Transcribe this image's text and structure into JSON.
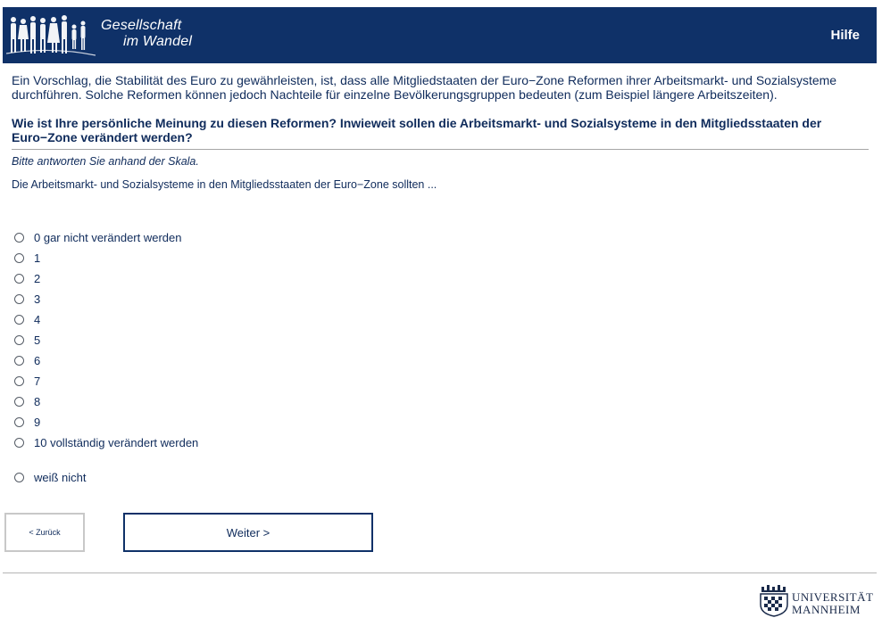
{
  "header": {
    "logo_line1": "Gesellschaft",
    "logo_line2": "im Wandel",
    "help_label": "Hilfe"
  },
  "question": {
    "intro": "Ein Vorschlag, die Stabilität des Euro zu gewährleisten, ist, dass alle Mitgliedstaaten der Euro−Zone Reformen ihrer Arbeitsmarkt- und Sozialsysteme durchführen. Solche Reformen können jedoch Nachteile für einzelne Bevölkerungsgruppen bedeuten (zum Beispiel längere Arbeitszeiten).",
    "text": "Wie ist Ihre persönliche Meinung zu diesen Reformen? Inwieweit sollen die Arbeitsmarkt- und Sozialsysteme in den Mitgliedsstaaten der Euro−Zone verändert werden?",
    "instruction": "Bitte antworten Sie anhand der Skala.",
    "stem": "Die Arbeitsmarkt- und Sozialsysteme in den Mitgliedsstaaten der Euro−Zone sollten ..."
  },
  "options": [
    "0 gar nicht verändert werden",
    "1",
    "2",
    "3",
    "4",
    "5",
    "6",
    "7",
    "8",
    "9",
    "10 vollständig verändert werden"
  ],
  "dont_know": "weiß nicht",
  "nav": {
    "back_label": "< Zurück",
    "next_label": "Weiter >"
  },
  "footer": {
    "university_line1": "UNIVERSITÄT",
    "university_line2": "MANNHEIM"
  },
  "colors": {
    "header_bg": "#0f3168",
    "text": "#0f2b5b"
  },
  "icons": {
    "survey_logo": "people-silhouettes-icon",
    "university_logo": "university-crest-icon"
  }
}
